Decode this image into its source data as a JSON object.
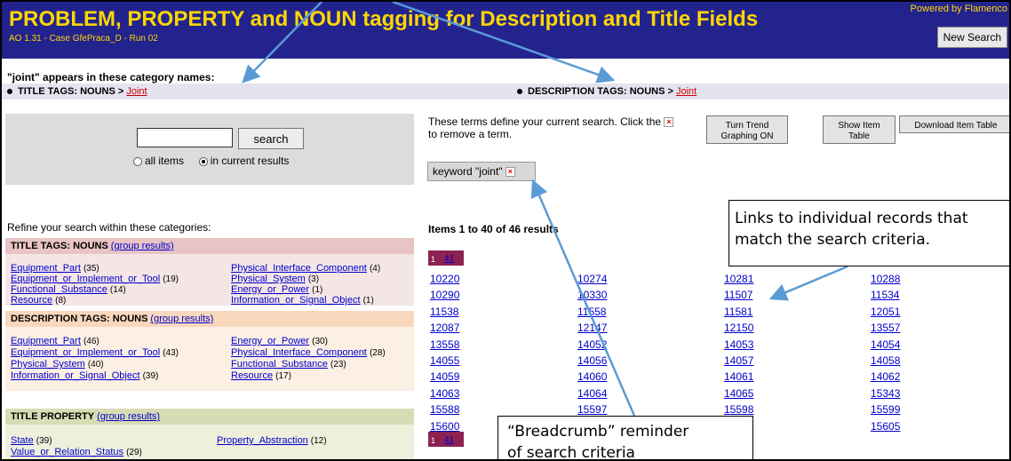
{
  "header": {
    "title": "PROBLEM, PROPERTY and NOUN tagging for Description and Title Fields",
    "subtitle": "AO 1.31 - Case GfePraca_D - Run 02",
    "powered_by": "Powered by Flamenco",
    "new_search_label": "New Search"
  },
  "appears_text": "\"joint\" appears in these category names:",
  "category_hits": [
    {
      "prefix": "TITLE TAGS: NOUNS > ",
      "link": "Joint"
    },
    {
      "prefix": "DESCRIPTION TAGS: NOUNS > ",
      "link": "Joint"
    }
  ],
  "search": {
    "input_value": "",
    "button_label": "search",
    "option_all": "all items",
    "option_current": "in current results",
    "selected": "in current results"
  },
  "refine_text": "Refine your search within these categories:",
  "groups": [
    {
      "title": "TITLE TAGS: NOUNS",
      "group_link": "(group results)",
      "color": "#e8c4c4",
      "body_color": "#f5e6e6",
      "items": [
        {
          "label": "Equipment_Part",
          "count": "(35)"
        },
        {
          "label": "Physical_Interface_Component",
          "count": "(4)"
        },
        {
          "label": "Equipment_or_Implement_or_Tool",
          "count": "(19)"
        },
        {
          "label": "Physical_System",
          "count": "(3)"
        },
        {
          "label": "Functional_Substance",
          "count": "(14)"
        },
        {
          "label": "Energy_or_Power",
          "count": "(1)"
        },
        {
          "label": "Resource",
          "count": "(8)"
        },
        {
          "label": "Information_or_Signal_Object",
          "count": "(1)"
        }
      ]
    },
    {
      "title": "DESCRIPTION TAGS: NOUNS",
      "group_link": "(group results)",
      "color": "#f8d8bc",
      "body_color": "#fcefe4",
      "items": [
        {
          "label": "Equipment_Part",
          "count": "(46)"
        },
        {
          "label": "Energy_or_Power",
          "count": "(30)"
        },
        {
          "label": "Equipment_or_Implement_or_Tool",
          "count": "(43)"
        },
        {
          "label": "Physical_Interface_Component",
          "count": "(28)"
        },
        {
          "label": "Physical_System",
          "count": "(40)"
        },
        {
          "label": "Functional_Substance",
          "count": "(23)"
        },
        {
          "label": "Information_or_Signal_Object",
          "count": "(39)"
        },
        {
          "label": "Resource",
          "count": "(17)"
        }
      ]
    },
    {
      "title": "TITLE PROPERTY",
      "group_link": "(group results)",
      "color": "#d8dcb4",
      "body_color": "#eef0dc",
      "items": [
        {
          "label": "State",
          "count": "(39)"
        },
        {
          "label": "Property_Abstraction",
          "count": "(12)"
        },
        {
          "label": "Value_or_Relation_Status",
          "count": "(29)"
        }
      ]
    }
  ],
  "current_search": {
    "define_text": "These terms define your current search. Click the",
    "define_text_2": "to remove a term.",
    "remove_symbol": "×",
    "keyword_chip": "keyword \"joint\""
  },
  "toolbar": {
    "trend_label_1": "Turn Trend",
    "trend_label_2": "Graphing ON",
    "show_table_1": "Show Item",
    "show_table_2": "Table",
    "download_label": "Download Item Table"
  },
  "results": {
    "count_text": "Items 1 to 40 of 46 results",
    "pager_current": "1",
    "pager_next": "41",
    "records": [
      [
        "10220",
        "10274",
        "10281",
        "10288"
      ],
      [
        "10290",
        "10330",
        "11507",
        "11534"
      ],
      [
        "11538",
        "11558",
        "11581",
        "12051"
      ],
      [
        "12087",
        "12147",
        "12150",
        "13557"
      ],
      [
        "13558",
        "14052",
        "14053",
        "14054"
      ],
      [
        "14055",
        "14056",
        "14057",
        "14058"
      ],
      [
        "14059",
        "14060",
        "14061",
        "14062"
      ],
      [
        "14063",
        "14064",
        "14065",
        "15343"
      ],
      [
        "15588",
        "15597",
        "15598",
        "15599"
      ],
      [
        "15600",
        "",
        "",
        "15605"
      ]
    ]
  },
  "callouts": {
    "links_line1": "Links to individual records that",
    "links_line2": "match the search criteria.",
    "breadcrumb_line1": "“Breadcrumb” reminder",
    "breadcrumb_line2": "of search criteria"
  },
  "colors": {
    "header_bg": "#23238e",
    "header_text": "#ffd700",
    "pager_bg": "#8b2252",
    "link": "#0000cc",
    "arrow": "#5b9bd5"
  }
}
